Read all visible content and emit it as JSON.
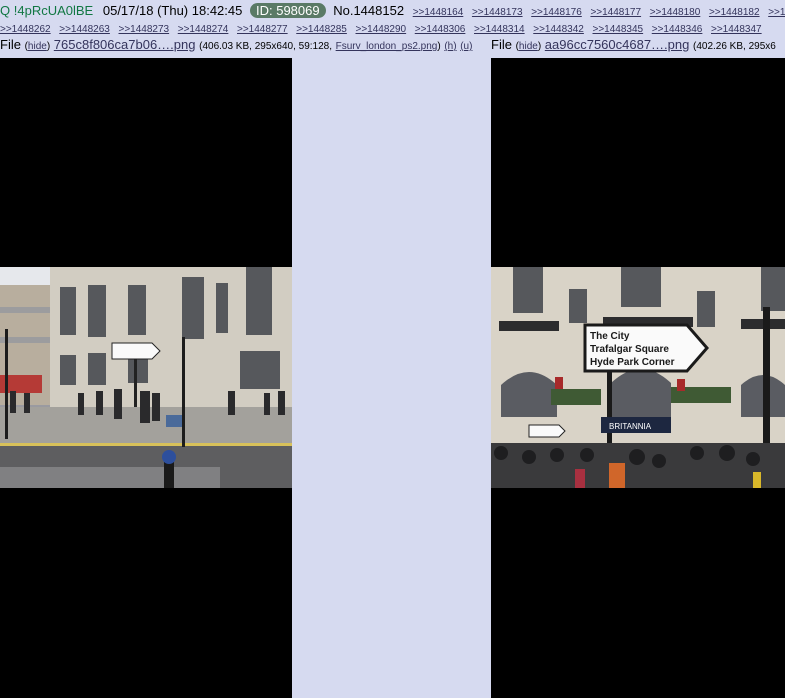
{
  "header": {
    "trip_q": "Q",
    "trip": "!4pRcUA0lBE",
    "date": "05/17/18 (Thu) 18:42:45",
    "id_label": "ID: 598069",
    "post_no": "No.1448152",
    "quotelinks_row1": [
      ">>1448164",
      ">>1448173",
      ">>1448176",
      ">>1448177",
      ">>1448180",
      ">>1448182",
      ">>1448"
    ],
    "quotelinks_row2": [
      ">>1448262",
      ">>1448263",
      ">>1448273",
      ">>1448274",
      ">>1448277",
      ">>1448285",
      ">>1448290",
      ">>1448306",
      ">>1448314",
      ">>1448342",
      ">>1448345",
      ">>1448346",
      ">>1448347"
    ]
  },
  "file1": {
    "prefix": "File",
    "hide": "hide",
    "name": "765c8f806ca7b06….png",
    "meta": "(406.03 KB, 295x640, 59:128,",
    "orig": "Fsurv_london_ps2.png",
    "h": "(h)",
    "u": "(u)"
  },
  "file2": {
    "prefix": "File",
    "hide": "hide",
    "name": "aa96cc7560c4687….png",
    "meta": "(402.26 KB, 295x6"
  },
  "image2_sign": {
    "line1": "The City",
    "line2": "Trafalgar Square",
    "line3": "Hyde Park Corner",
    "shop": "BRITANNIA"
  },
  "colors": {
    "background": "#d6daf0",
    "trip": "#117743",
    "link": "#34345c",
    "id_badge": "#5a7a66"
  }
}
